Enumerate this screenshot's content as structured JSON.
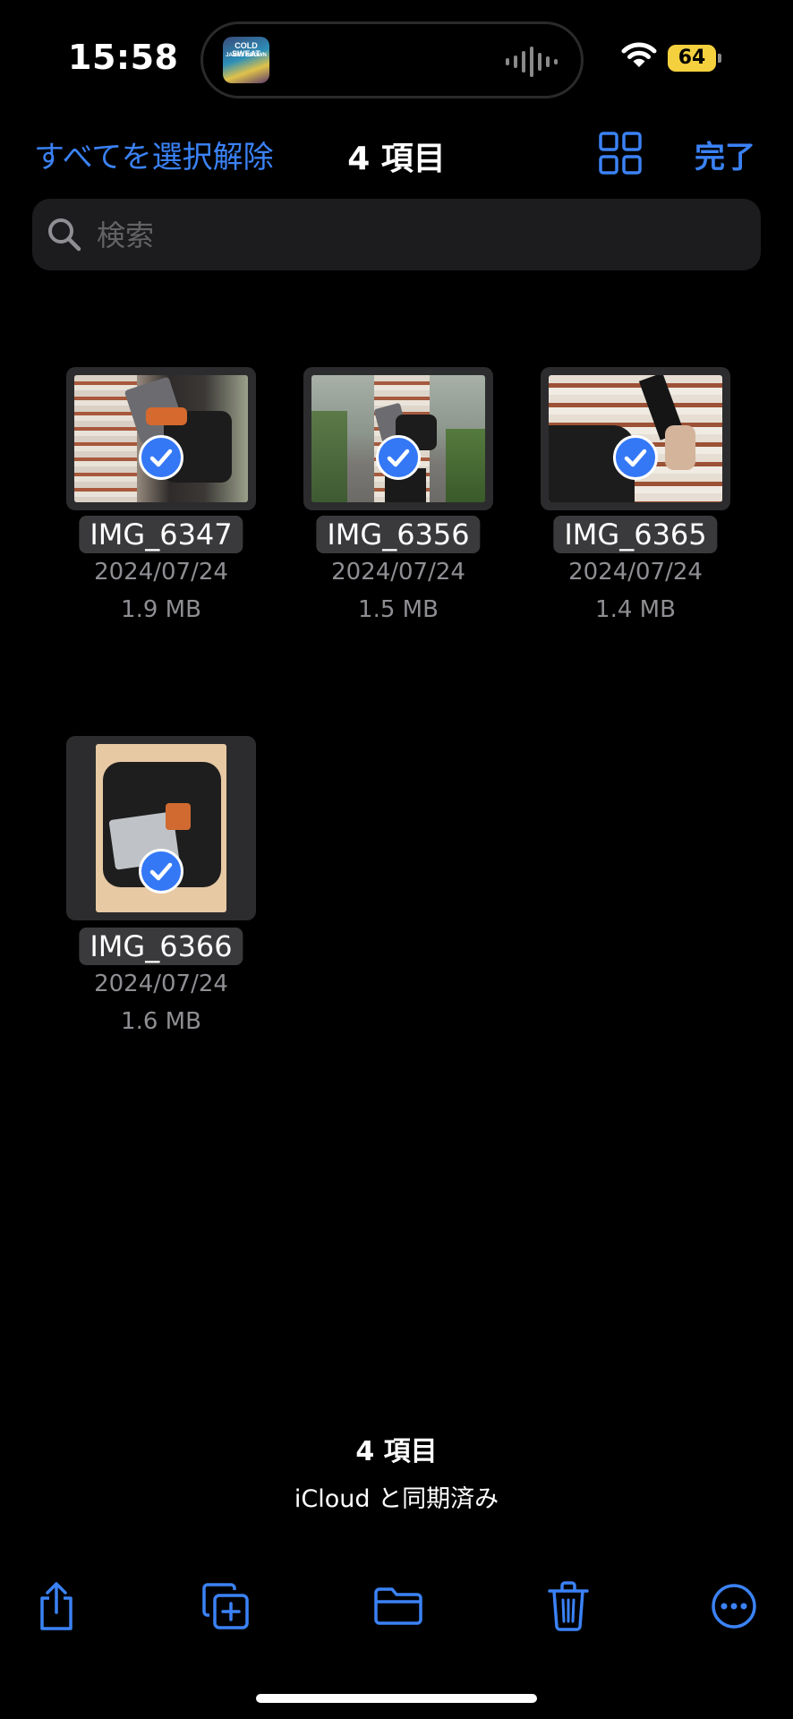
{
  "status_bar": {
    "time": "15:58",
    "battery": "64",
    "now_playing_art_title": "COLD SWEAT",
    "now_playing_art_artist": "JAMES BROWN"
  },
  "nav": {
    "deselect_all": "すべてを選択解除",
    "title": "4 項目",
    "done": "完了"
  },
  "search": {
    "placeholder": "検索",
    "value": ""
  },
  "files": [
    {
      "name": "IMG_6347",
      "date": "2024/07/24",
      "size": "1.9 MB"
    },
    {
      "name": "IMG_6356",
      "date": "2024/07/24",
      "size": "1.5 MB"
    },
    {
      "name": "IMG_6365",
      "date": "2024/07/24",
      "size": "1.4 MB"
    },
    {
      "name": "IMG_6366",
      "date": "2024/07/24",
      "size": "1.6 MB"
    }
  ],
  "footer": {
    "count": "4 項目",
    "sync_status": "iCloud と同期済み"
  },
  "toolbar": {
    "icons": [
      "share-icon",
      "duplicate-icon",
      "folder-icon",
      "trash-icon",
      "more-icon"
    ]
  },
  "colors": {
    "accent": "#3b82f6",
    "background": "#000000",
    "battery": "#f4d03f",
    "checkmark": "#3478f6"
  }
}
